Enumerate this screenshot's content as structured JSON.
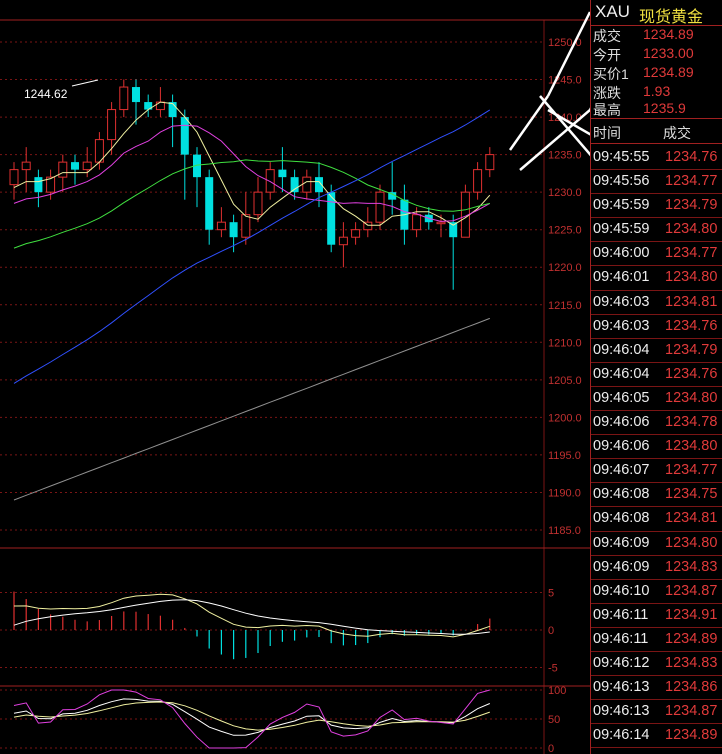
{
  "chart": {
    "peak_label": "1244.62",
    "price_ticks": [
      "1250.0",
      "1245.0",
      "1240.0",
      "1235.0",
      "1230.0",
      "1225.0",
      "1220.0",
      "1215.0",
      "1210.0",
      "1205.0",
      "1200.0",
      "1195.0",
      "1190.0",
      "1185.0"
    ],
    "macd_ticks": [
      "5",
      "0",
      "-5"
    ],
    "kdj_ticks": [
      "100",
      "50",
      "0"
    ],
    "colors": {
      "up": "#e03030",
      "down": "#00e0e0",
      "grid": "#7a1515",
      "ma5": "#f0f0a0",
      "ma10": "#e040e0",
      "ma20": "#40e040",
      "ma60": "#3050ff",
      "ma120": "#909090"
    },
    "candles": [
      [
        1231,
        1233,
        1229,
        1234
      ],
      [
        1233,
        1234,
        1230,
        1236
      ],
      [
        1232,
        1230,
        1228,
        1233
      ],
      [
        1230,
        1232,
        1229,
        1233
      ],
      [
        1232,
        1234,
        1230,
        1235
      ],
      [
        1234,
        1233,
        1231,
        1235
      ],
      [
        1233,
        1234,
        1232,
        1236
      ],
      [
        1234,
        1237,
        1233,
        1238
      ],
      [
        1237,
        1241,
        1235,
        1242
      ],
      [
        1241,
        1244,
        1240,
        1245
      ],
      [
        1244,
        1242,
        1239,
        1245
      ],
      [
        1242,
        1241,
        1240,
        1243
      ],
      [
        1241,
        1242,
        1240,
        1244
      ],
      [
        1242,
        1240,
        1236,
        1243
      ],
      [
        1240,
        1235,
        1229,
        1241
      ],
      [
        1235,
        1232,
        1228,
        1236
      ],
      [
        1232,
        1225,
        1223,
        1233
      ],
      [
        1225,
        1226,
        1224,
        1228
      ],
      [
        1226,
        1224,
        1222,
        1227
      ],
      [
        1224,
        1227,
        1223,
        1230
      ],
      [
        1227,
        1230,
        1226,
        1232
      ],
      [
        1230,
        1233,
        1229,
        1234
      ],
      [
        1233,
        1232,
        1230,
        1236
      ],
      [
        1232,
        1230,
        1229,
        1233
      ],
      [
        1230,
        1232,
        1229,
        1233
      ],
      [
        1232,
        1230,
        1228,
        1234
      ],
      [
        1230,
        1223,
        1222,
        1231
      ],
      [
        1223,
        1224,
        1220,
        1226
      ],
      [
        1224,
        1225,
        1223,
        1226
      ],
      [
        1225,
        1226,
        1224,
        1228
      ],
      [
        1226,
        1230,
        1225,
        1231
      ],
      [
        1230,
        1229,
        1227,
        1234
      ],
      [
        1229,
        1225,
        1223,
        1231
      ],
      [
        1225,
        1227,
        1224,
        1228
      ],
      [
        1227,
        1226,
        1225,
        1228
      ],
      [
        1226,
        1226,
        1224,
        1227
      ],
      [
        1226,
        1224,
        1217,
        1227
      ],
      [
        1224,
        1230,
        1224,
        1231
      ],
      [
        1230,
        1233,
        1229,
        1234
      ],
      [
        1233,
        1235,
        1232,
        1236
      ]
    ]
  },
  "panel": {
    "symbol": "XAU",
    "name": "现货黄金",
    "quotes": [
      {
        "label": "成交",
        "value": "1234.89"
      },
      {
        "label": "今开",
        "value": "1233.00"
      },
      {
        "label": "买价1",
        "value": "1234.89"
      },
      {
        "label": "涨跌",
        "value": "1.93"
      },
      {
        "label": "最高",
        "value": "1235.9"
      }
    ],
    "col_time": "时间",
    "col_price": "成交",
    "trades": [
      {
        "time": "09:45:55",
        "price": "1234.76"
      },
      {
        "time": "09:45:56",
        "price": "1234.77"
      },
      {
        "time": "09:45:59",
        "price": "1234.79"
      },
      {
        "time": "09:45:59",
        "price": "1234.80"
      },
      {
        "time": "09:46:00",
        "price": "1234.77"
      },
      {
        "time": "09:46:01",
        "price": "1234.80"
      },
      {
        "time": "09:46:03",
        "price": "1234.81"
      },
      {
        "time": "09:46:03",
        "price": "1234.76"
      },
      {
        "time": "09:46:04",
        "price": "1234.79"
      },
      {
        "time": "09:46:04",
        "price": "1234.76"
      },
      {
        "time": "09:46:05",
        "price": "1234.80"
      },
      {
        "time": "09:46:06",
        "price": "1234.78"
      },
      {
        "time": "09:46:06",
        "price": "1234.80"
      },
      {
        "time": "09:46:07",
        "price": "1234.77"
      },
      {
        "time": "09:46:08",
        "price": "1234.75"
      },
      {
        "time": "09:46:08",
        "price": "1234.81"
      },
      {
        "time": "09:46:09",
        "price": "1234.80"
      },
      {
        "time": "09:46:09",
        "price": "1234.83"
      },
      {
        "time": "09:46:10",
        "price": "1234.87"
      },
      {
        "time": "09:46:11",
        "price": "1234.91"
      },
      {
        "time": "09:46:11",
        "price": "1234.89"
      },
      {
        "time": "09:46:12",
        "price": "1234.83"
      },
      {
        "time": "09:46:13",
        "price": "1234.86"
      },
      {
        "time": "09:46:13",
        "price": "1234.87"
      },
      {
        "time": "09:46:14",
        "price": "1234.89"
      }
    ]
  }
}
